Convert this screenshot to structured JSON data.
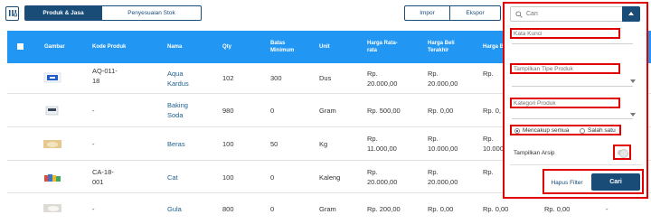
{
  "tabs": [
    {
      "label": "Produk & Jasa",
      "active": true
    },
    {
      "label": "Penyesuaian Stok",
      "active": false
    }
  ],
  "toolbar": {
    "import_label": "Impor",
    "export_label": "Ekspor"
  },
  "colors": {
    "brand": "#1a4c78",
    "header": "#2196f3",
    "highlight": "#e00000",
    "link": "#1e5f8e"
  },
  "table": {
    "headers": {
      "image": "Gambar",
      "code": "Kode Produk",
      "name": "Nama",
      "qty": "Qty",
      "min_limit": "Batas Minimum",
      "unit": "Unit",
      "avg_price": "Harga Rata-rata",
      "last_buy": "Harga Beli Terakhir",
      "buy_partial": "Harga Be"
    },
    "rows": [
      {
        "image_icon": "product-aqua-image",
        "code": "AQ-011-18",
        "name": "Aqua Kardus",
        "qty": "102",
        "min": "300",
        "unit": "Dus",
        "avg": "Rp. 20.000,00",
        "last": "Rp. 20.000,00",
        "buy": "Rp."
      },
      {
        "image_icon": "product-baking-soda-image",
        "code": "-",
        "name": "Baking Soda",
        "qty": "980",
        "min": "0",
        "unit": "Gram",
        "avg": "Rp. 500,00",
        "last": "Rp. 0,00",
        "buy": "Rp. 0,"
      },
      {
        "image_icon": "product-rice-image",
        "code": "-",
        "name": "Beras",
        "qty": "100",
        "min": "50",
        "unit": "Kg",
        "avg": "Rp. 11.000,00",
        "last": "Rp. 10.000,00",
        "buy": "Rp. 10.000,"
      },
      {
        "image_icon": "product-paint-image",
        "code": "CA-18-001",
        "name": "Cat",
        "qty": "100",
        "min": "0",
        "unit": "Kaleng",
        "avg": "Rp. 20.000,00",
        "last": "Rp. 20.000,00",
        "buy": "Rp."
      },
      {
        "image_icon": "product-sugar-image",
        "code": "-",
        "name": "Gula",
        "qty": "800",
        "min": "0",
        "unit": "Gram",
        "avg": "Rp. 200,00",
        "last": "Rp. 0,00",
        "buy": "Rp. 0,00",
        "extra": "Rp. 0,00",
        "extra2": "-"
      }
    ]
  },
  "filter": {
    "search_placeholder": "Cari",
    "keyword_placeholder": "Kata Kunci",
    "type_placeholder": "Tampilkan Tipe Produk",
    "category_placeholder": "Kategori Produk",
    "match_all": "Mencakup semua",
    "match_any": "Salah satu",
    "match_selected": "all",
    "archive_label": "Tampilkan Arsip",
    "archive_on": false,
    "clear_label": "Hapus Filter",
    "search_label": "Cari"
  }
}
